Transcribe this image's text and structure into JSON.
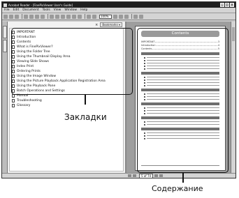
{
  "window": {
    "title": "Acrobat Reader - [FinePixViewer User's Guide]",
    "controls": [
      "_",
      "□",
      "×"
    ]
  },
  "menubar": [
    "File",
    "Edit",
    "Document",
    "Tools",
    "View",
    "Window",
    "Help"
  ],
  "toolbar": {
    "zoom": "100%"
  },
  "bookmarks_pane": {
    "close": "×",
    "options": "Bookmarks ▾",
    "items": [
      "IMPORTANT",
      "Introduction",
      "Contents",
      "What is FinePixViewer?",
      "Using the Folder Tree",
      "Using the Thumbnail Display Area",
      "Viewing Slide Shows",
      "Index Print",
      "Ordering Prints",
      "Using the Image Window",
      "Using the Picture Playback Application Registration Area",
      "Using the Playback Pane",
      "Batch Operations and Settings",
      "Manual",
      "Troubleshooting",
      "Glossary"
    ]
  },
  "document_page": {
    "banner": "Contents",
    "toc": [
      {
        "label": "IMPORTANT",
        "page": "3"
      },
      {
        "label": "Introduction",
        "page": "4"
      },
      {
        "label": "Contents",
        "page": "5"
      }
    ]
  },
  "status": {
    "page": "5 of 74"
  },
  "annotations": {
    "bookmarks_label": "Закладки",
    "contents_label": "Содержание"
  }
}
